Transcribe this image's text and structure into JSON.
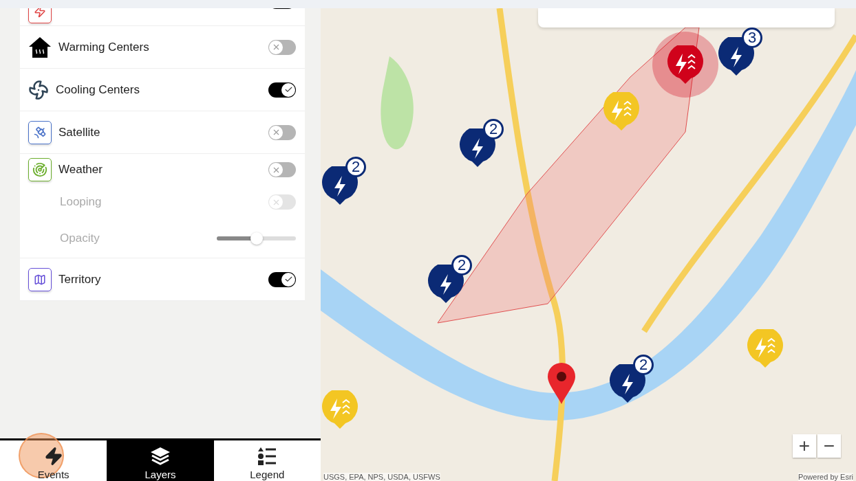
{
  "layers": [
    {
      "kind": "cut",
      "on": true
    },
    {
      "kind": "toggle",
      "label": "Warming Centers",
      "on": false
    },
    {
      "kind": "toggle",
      "label": "Cooling Centers",
      "on": true
    },
    {
      "kind": "toggle",
      "label": "Satellite",
      "on": false
    },
    {
      "kind": "toggle",
      "label": "Weather",
      "on": false
    },
    {
      "kind": "subtoggle",
      "label": "Looping",
      "on": false,
      "disabled": true
    },
    {
      "kind": "slider",
      "label": "Opacity",
      "level": 0.5,
      "disabled": true
    },
    {
      "kind": "toggle",
      "label": "Territory",
      "on": true
    }
  ],
  "tabs": [
    {
      "label": "Events",
      "selected": false
    },
    {
      "label": "Layers",
      "selected": true
    },
    {
      "label": "Legend",
      "selected": false
    }
  ],
  "pins": [
    {
      "kind": "cluster",
      "count": "2"
    },
    {
      "kind": "cluster",
      "count": "2"
    },
    {
      "kind": "cluster",
      "count": "2"
    },
    {
      "kind": "cluster",
      "count": "2"
    },
    {
      "kind": "cluster",
      "count": "3"
    },
    {
      "kind": "warning",
      "color": "#f3c623"
    },
    {
      "kind": "warning",
      "color": "#f3c623"
    },
    {
      "kind": "warning",
      "color": "#f3c623"
    },
    {
      "kind": "warning",
      "color": "#d0021b"
    },
    {
      "kind": "location"
    }
  ],
  "attribution": {
    "sources": "USGS, EPA, NPS, USDA, USFWS",
    "powered": "Powered by Esri"
  },
  "zoom": {
    "in": "+",
    "out": "−"
  }
}
